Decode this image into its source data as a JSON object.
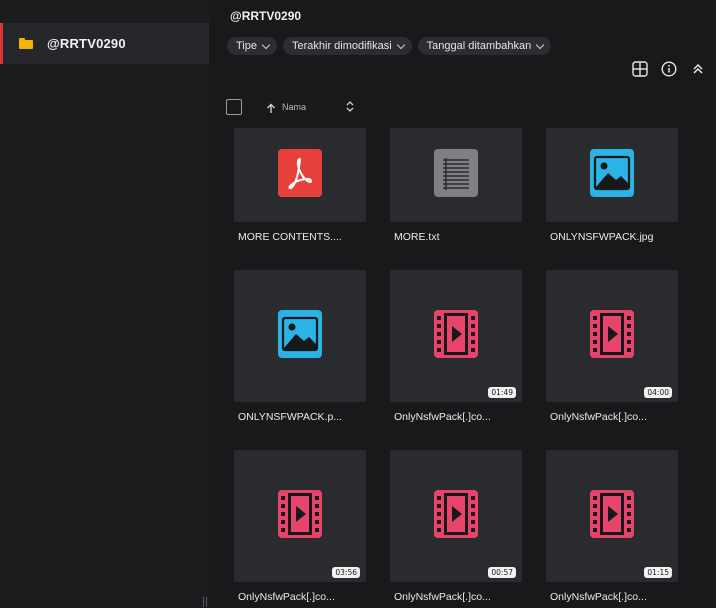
{
  "sidebar": {
    "items": [
      {
        "label": "@RRTV0290",
        "icon": "folder-icon",
        "active": true
      }
    ]
  },
  "header": {
    "title": "@RRTV0290"
  },
  "filters": [
    {
      "label": "Tipe"
    },
    {
      "label": "Terakhir dimodifikasi"
    },
    {
      "label": "Tanggal ditambahkan"
    }
  ],
  "toolbar": {
    "icons": [
      "grid-view-icon",
      "info-icon",
      "collapse-icon"
    ]
  },
  "list_header": {
    "column_name": "Nama"
  },
  "files": [
    {
      "name": "MORE CONTENTS....",
      "type": "pdf"
    },
    {
      "name": "MORE.txt",
      "type": "txt"
    },
    {
      "name": "ONLYNSFWPACK.jpg",
      "type": "image"
    },
    {
      "name": "ONLYNSFWPACK.p...",
      "type": "image"
    },
    {
      "name": "OnlyNsfwPack[.]co...",
      "type": "video",
      "duration": "01:49"
    },
    {
      "name": "OnlyNsfwPack[.]co...",
      "type": "video",
      "duration": "04:00"
    },
    {
      "name": "OnlyNsfwPack[.]co...",
      "type": "video",
      "duration": "03:56"
    },
    {
      "name": "OnlyNsfwPack[.]co...",
      "type": "video",
      "duration": "00:57"
    },
    {
      "name": "OnlyNsfwPack[.]co...",
      "type": "video",
      "duration": "01:15"
    }
  ],
  "colors": {
    "accent": "#d8363c",
    "folder": "#f4b400",
    "pdf": "#e8413c",
    "txt": "#7f8083",
    "image": "#2bb3e6",
    "video": "#e8436a"
  }
}
